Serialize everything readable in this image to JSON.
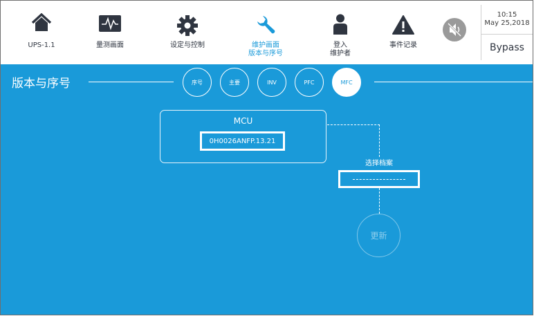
{
  "nav": [
    {
      "key": "ups",
      "label": "UPS-1.1",
      "sub": "",
      "icon": "home-icon"
    },
    {
      "key": "measure",
      "label": "量测画面",
      "sub": "",
      "icon": "waveform-icon"
    },
    {
      "key": "setup",
      "label": "设定与控制",
      "sub": "",
      "icon": "gear-icon"
    },
    {
      "key": "maintenance",
      "label": "维护画面",
      "sub": "版本与序号",
      "icon": "wrench-icon"
    },
    {
      "key": "login",
      "label": "登入",
      "sub": "维护者",
      "icon": "user-icon"
    },
    {
      "key": "events",
      "label": "事件记录",
      "sub": "",
      "icon": "warning-icon"
    }
  ],
  "mute_icon": "speaker-muted-icon",
  "status": {
    "time": "10:15",
    "date": "May 25,2018",
    "mode": "Bypass"
  },
  "page": {
    "title": "版本与序号"
  },
  "tabs": [
    {
      "label": "序号"
    },
    {
      "label": "主要"
    },
    {
      "label": "INV"
    },
    {
      "label": "PFC"
    },
    {
      "label": "MFC"
    }
  ],
  "active_tab": "MFC",
  "mcu": {
    "label": "MCU",
    "value": "0H0026ANFP.13.21"
  },
  "file": {
    "label": "选择档案"
  },
  "update": {
    "label": "更新"
  },
  "colors": {
    "accent": "#1a9ad9",
    "icon_dark": "#2f3540",
    "mute_circle": "#9a9a9a"
  }
}
